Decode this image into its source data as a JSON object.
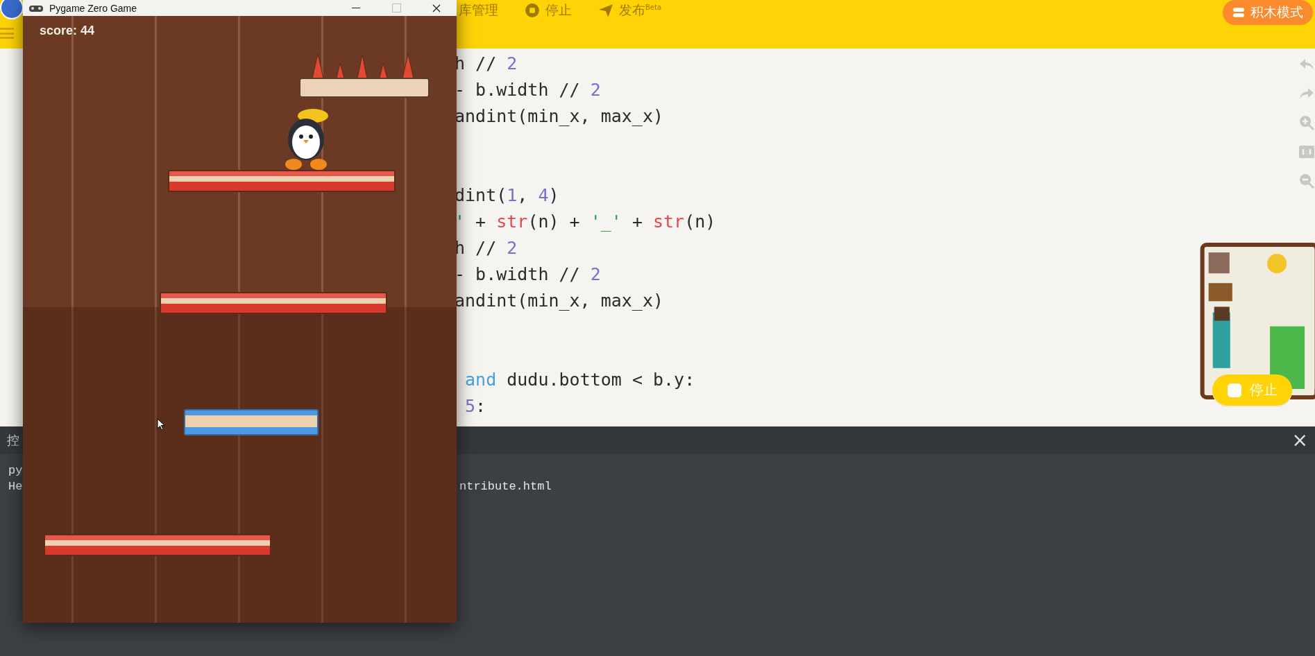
{
  "app_toolbar": {
    "items": [
      {
        "label": "库管理"
      },
      {
        "label": "停止"
      },
      {
        "label": "发布$^{Beta}$"
      }
    ],
    "mode_button": "积木模式"
  },
  "code_blocks": [
    [
      [
        {
          "t": "h // ",
          "kind": "plain"
        },
        {
          "t": "2",
          "kind": "number"
        }
      ],
      [
        {
          "t": "- b.width // ",
          "kind": "plain"
        },
        {
          "t": "2",
          "kind": "number"
        }
      ],
      [
        {
          "t": "andint(min_x, max_x)",
          "kind": "plain"
        }
      ]
    ],
    [
      [
        {
          "t": "dint(",
          "kind": "plain"
        },
        {
          "t": "1",
          "kind": "number"
        },
        {
          "t": ", ",
          "kind": "plain"
        },
        {
          "t": "4",
          "kind": "number"
        },
        {
          "t": ")",
          "kind": "plain"
        }
      ],
      [
        {
          "t": "'",
          "kind": "string"
        },
        {
          "t": " + ",
          "kind": "plain"
        },
        {
          "t": "str",
          "kind": "builtin"
        },
        {
          "t": "(n) + ",
          "kind": "plain"
        },
        {
          "t": "'_'",
          "kind": "string"
        },
        {
          "t": " + ",
          "kind": "plain"
        },
        {
          "t": "str",
          "kind": "builtin"
        },
        {
          "t": "(n)",
          "kind": "plain"
        }
      ],
      [
        {
          "t": "h // ",
          "kind": "plain"
        },
        {
          "t": "2",
          "kind": "number"
        }
      ],
      [
        {
          "t": "- b.width // ",
          "kind": "plain"
        },
        {
          "t": "2",
          "kind": "number"
        }
      ],
      [
        {
          "t": "andint(min_x, max_x)",
          "kind": "plain"
        }
      ]
    ],
    [
      [
        {
          "t": " and",
          "kind": "keyword"
        },
        {
          "t": " dudu.bottom < b.y:",
          "kind": "plain"
        }
      ],
      [
        {
          "t": " 5",
          "kind": "number"
        },
        {
          "t": ":",
          "kind": "plain"
        }
      ]
    ]
  ],
  "stop_button": "停止",
  "console": {
    "title": "控",
    "close": "×",
    "lines": [
      [
        "py"
      ],
      [
        "He",
        "ntribute.html"
      ]
    ]
  },
  "game_window": {
    "title": "Pygame Zero Game",
    "score": "score: 44"
  }
}
